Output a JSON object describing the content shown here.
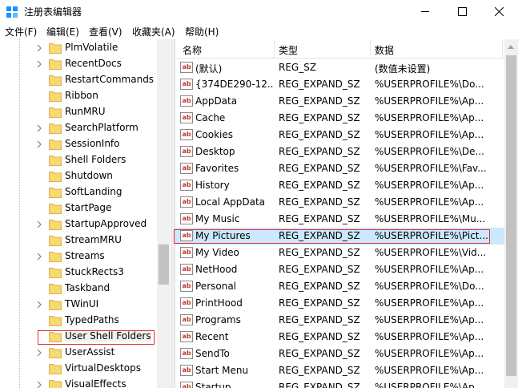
{
  "window": {
    "title": "注册表编辑器",
    "icons": {
      "app": "regedit-icon",
      "minimize": "minimize-icon",
      "maximize": "maximize-icon",
      "close": "close-icon"
    }
  },
  "menu": {
    "items": [
      "文件(F)",
      "编辑(E)",
      "查看(V)",
      "收藏夹(A)",
      "帮助(H)"
    ]
  },
  "tree": {
    "selected": "User Shell Folders",
    "items": [
      {
        "label": "PlmVolatile",
        "expandable": true
      },
      {
        "label": "RecentDocs",
        "expandable": true
      },
      {
        "label": "RestartCommands",
        "expandable": false
      },
      {
        "label": "Ribbon",
        "expandable": false
      },
      {
        "label": "RunMRU",
        "expandable": false
      },
      {
        "label": "SearchPlatform",
        "expandable": true
      },
      {
        "label": "SessionInfo",
        "expandable": true
      },
      {
        "label": "Shell Folders",
        "expandable": false
      },
      {
        "label": "Shutdown",
        "expandable": false
      },
      {
        "label": "SoftLanding",
        "expandable": false
      },
      {
        "label": "StartPage",
        "expandable": false
      },
      {
        "label": "StartupApproved",
        "expandable": true
      },
      {
        "label": "StreamMRU",
        "expandable": false
      },
      {
        "label": "Streams",
        "expandable": true
      },
      {
        "label": "StuckRects3",
        "expandable": false
      },
      {
        "label": "Taskband",
        "expandable": false
      },
      {
        "label": "TWinUI",
        "expandable": true
      },
      {
        "label": "TypedPaths",
        "expandable": false
      },
      {
        "label": "User Shell Folders",
        "expandable": false
      },
      {
        "label": "UserAssist",
        "expandable": true
      },
      {
        "label": "VirtualDesktops",
        "expandable": false
      },
      {
        "label": "VisualEffects",
        "expandable": true
      }
    ]
  },
  "list": {
    "columns": [
      "名称",
      "类型",
      "数据"
    ],
    "highlighted": "My Pictures",
    "rows": [
      {
        "name": "(默认)",
        "type": "REG_SZ",
        "data": "(数值未设置)"
      },
      {
        "name": "{374DE290-12...",
        "type": "REG_EXPAND_SZ",
        "data": "%USERPROFILE%\\Do..."
      },
      {
        "name": "AppData",
        "type": "REG_EXPAND_SZ",
        "data": "%USERPROFILE%\\Ap..."
      },
      {
        "name": "Cache",
        "type": "REG_EXPAND_SZ",
        "data": "%USERPROFILE%\\Ap..."
      },
      {
        "name": "Cookies",
        "type": "REG_EXPAND_SZ",
        "data": "%USERPROFILE%\\Ap..."
      },
      {
        "name": "Desktop",
        "type": "REG_EXPAND_SZ",
        "data": "%USERPROFILE%\\De..."
      },
      {
        "name": "Favorites",
        "type": "REG_EXPAND_SZ",
        "data": "%USERPROFILE%\\Fav..."
      },
      {
        "name": "History",
        "type": "REG_EXPAND_SZ",
        "data": "%USERPROFILE%\\Ap..."
      },
      {
        "name": "Local AppData",
        "type": "REG_EXPAND_SZ",
        "data": "%USERPROFILE%\\Ap..."
      },
      {
        "name": "My Music",
        "type": "REG_EXPAND_SZ",
        "data": "%USERPROFILE%\\Mu..."
      },
      {
        "name": "My Pictures",
        "type": "REG_EXPAND_SZ",
        "data": "%USERPROFILE%\\Pict..."
      },
      {
        "name": "My Video",
        "type": "REG_EXPAND_SZ",
        "data": "%USERPROFILE%\\Vid..."
      },
      {
        "name": "NetHood",
        "type": "REG_EXPAND_SZ",
        "data": "%USERPROFILE%\\Ap..."
      },
      {
        "name": "Personal",
        "type": "REG_EXPAND_SZ",
        "data": "%USERPROFILE%\\Do..."
      },
      {
        "name": "PrintHood",
        "type": "REG_EXPAND_SZ",
        "data": "%USERPROFILE%\\Ap..."
      },
      {
        "name": "Programs",
        "type": "REG_EXPAND_SZ",
        "data": "%USERPROFILE%\\Ap..."
      },
      {
        "name": "Recent",
        "type": "REG_EXPAND_SZ",
        "data": "%USERPROFILE%\\Ap..."
      },
      {
        "name": "SendTo",
        "type": "REG_EXPAND_SZ",
        "data": "%USERPROFILE%\\Ap..."
      },
      {
        "name": "Start Menu",
        "type": "REG_EXPAND_SZ",
        "data": "%USERPROFILE%\\Ap..."
      },
      {
        "name": "Startup",
        "type": "REG_EXPAND_SZ",
        "data": "%USERPROFILE%\\Ap..."
      }
    ]
  },
  "colors": {
    "selection_outline": "#e03030",
    "row_highlight": "#cce8ff",
    "folder_yellow": "#f8d775",
    "value_icon_text": "#c0392b"
  }
}
